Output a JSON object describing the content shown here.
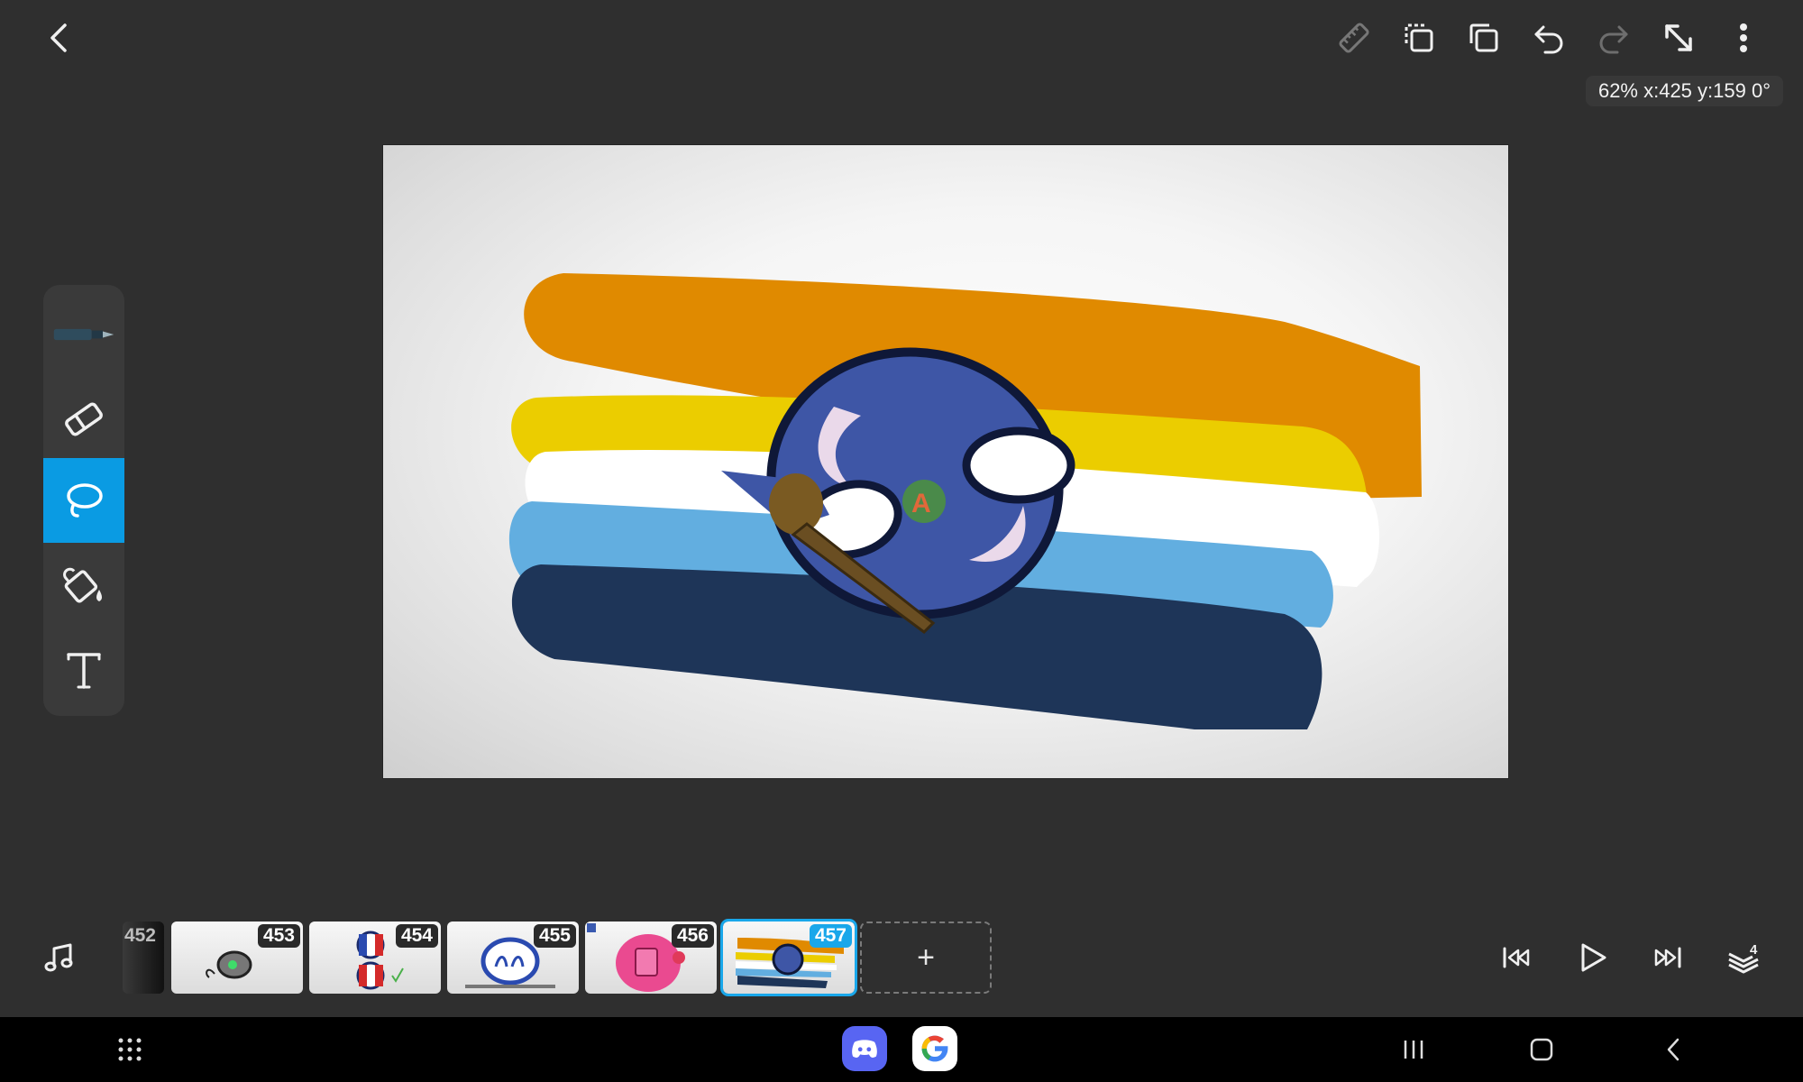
{
  "top_bar": {
    "icons": [
      "back-icon",
      "ruler-icon",
      "copy-frame-icon",
      "paste-frame-icon",
      "undo-icon",
      "redo-icon",
      "expand-icon",
      "more-menu-icon"
    ]
  },
  "status": {
    "readout": "62% x:425 y:159 0°"
  },
  "tools": [
    {
      "name": "pen-icon",
      "active": false
    },
    {
      "name": "eraser-icon",
      "active": false
    },
    {
      "name": "lasso-icon",
      "active": true
    },
    {
      "name": "fill-bucket-icon",
      "active": false
    },
    {
      "name": "text-tool-icon",
      "active": false
    }
  ],
  "colors": {
    "accent": "#0a9be3",
    "flag_orange": "#e08a00",
    "flag_yellow": "#ebcd00",
    "flag_white": "#ffffff",
    "flag_light_blue": "#62aee0",
    "flag_navy": "#1e3558",
    "ball_blue": "#3e56a6"
  },
  "timeline": {
    "frames": [
      {
        "number": "452"
      },
      {
        "number": "453"
      },
      {
        "number": "454"
      },
      {
        "number": "455"
      },
      {
        "number": "456"
      },
      {
        "number": "457",
        "selected": true
      }
    ],
    "add_label": "+"
  },
  "playback": {
    "icons": [
      "music-icon",
      "skip-start-icon",
      "play-icon",
      "skip-end-icon",
      "layers-icon"
    ],
    "layers_count": "4"
  },
  "nav_bar": {
    "icons": [
      "app-drawer-icon",
      "discord-app-icon",
      "google-app-icon",
      "recents-icon",
      "home-icon",
      "nav-back-icon"
    ]
  }
}
